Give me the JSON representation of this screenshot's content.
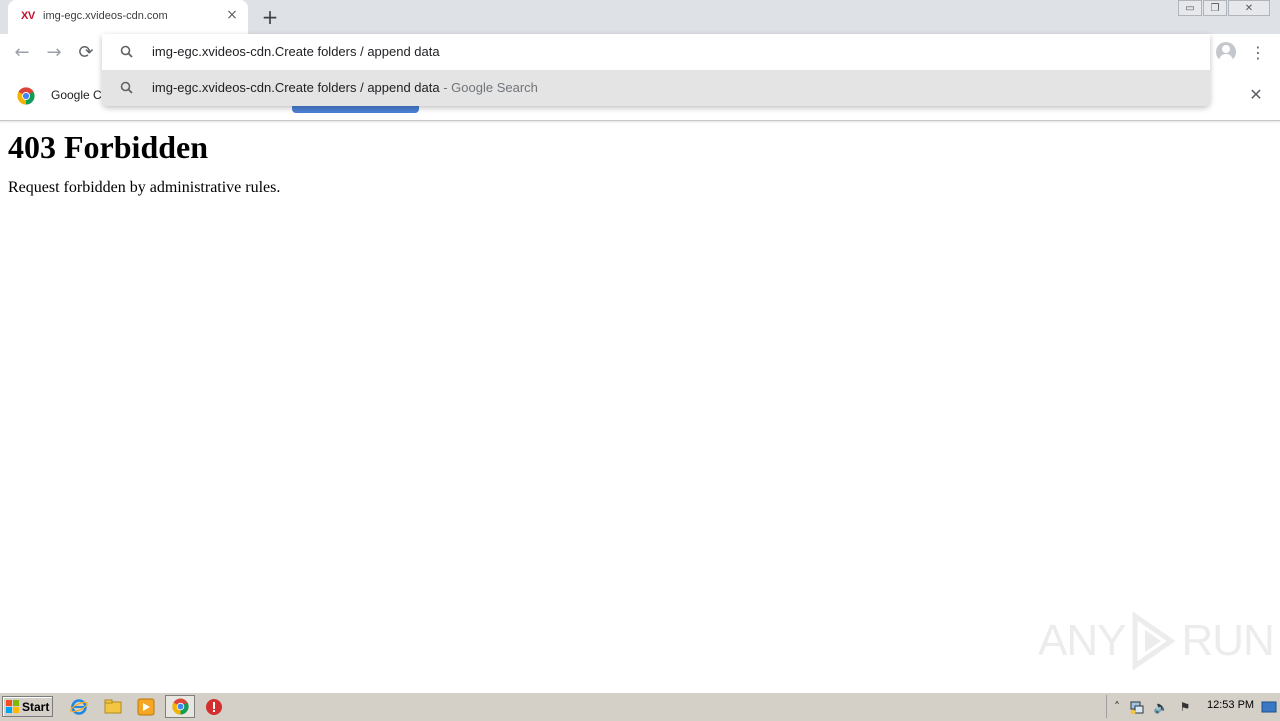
{
  "browser": {
    "tab": {
      "favicon_text": "XV",
      "title": "img-egc.xvideos-cdn.com",
      "close_glyph": "×"
    },
    "new_tab_glyph": "+",
    "window_controls": {
      "minimize": "▭",
      "restore": "❐",
      "close": "✕"
    },
    "nav": {
      "back": "←",
      "forward": "→",
      "reload": "⟳"
    },
    "menu_glyph": "⋮",
    "omnibox": {
      "input_value": "img-egc.xvideos-cdn.Create folders / append data",
      "suggestion_text": "img-egc.xvideos-cdn.Create folders / append data",
      "suggestion_suffix": " - Google Search"
    },
    "infobar": {
      "text": "Google Chrome isn't your default browser",
      "close_glyph": "✕"
    }
  },
  "page": {
    "heading": "403 Forbidden",
    "message": "Request forbidden by administrative rules."
  },
  "watermark": {
    "left": "ANY",
    "right": "RUN"
  },
  "taskbar": {
    "start_label": "Start",
    "clock": "12:53 PM",
    "tray_glyphs": {
      "expand": "˄",
      "volume": "🔈",
      "flag": "⚑"
    }
  },
  "colors": {
    "tab_strip": "#dee1e6",
    "favicon_red": "#c8102e",
    "infobar_button": "#4a7fd4",
    "taskbar": "#d4d0c8"
  }
}
